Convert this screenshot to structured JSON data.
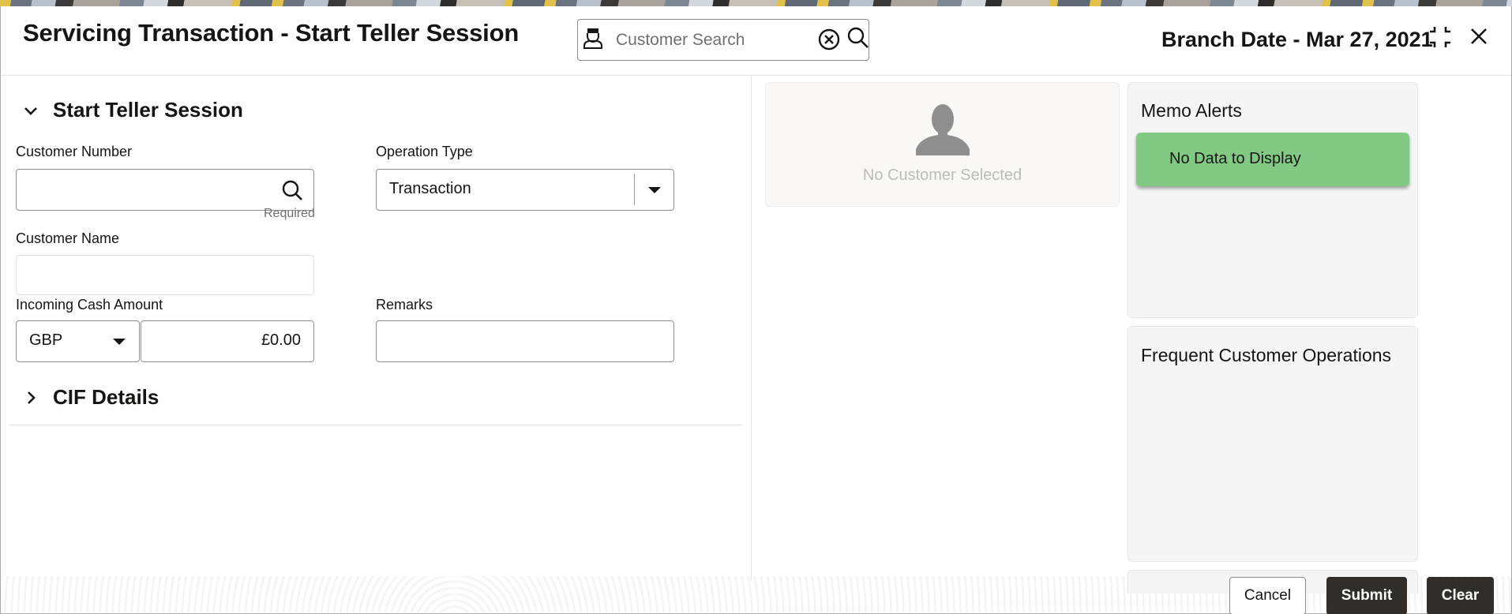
{
  "header": {
    "title": "Servicing Transaction - Start Teller Session",
    "customer_search": {
      "placeholder": "Customer Search",
      "value": ""
    },
    "branch_date": "Branch Date - Mar 27, 2021",
    "icons": {
      "person": "customer-person-icon",
      "clear": "clear-circle-x-icon",
      "search": "search-icon",
      "collapse": "collapse-icon",
      "close": "close-icon"
    }
  },
  "form": {
    "section_title": "Start Teller Session",
    "customer_number": {
      "label": "Customer Number",
      "value": "",
      "hint": "Required"
    },
    "operation_type": {
      "label": "Operation Type",
      "selected": "Transaction"
    },
    "customer_name": {
      "label": "Customer Name",
      "value": ""
    },
    "incoming_cash": {
      "label": "Incoming Cash Amount",
      "currency": "GBP",
      "amount": "£0.00"
    },
    "remarks": {
      "label": "Remarks",
      "value": ""
    },
    "cif_section_title": "CIF Details"
  },
  "customer_card": {
    "message": "No Customer Selected"
  },
  "memo_alerts": {
    "title": "Memo Alerts",
    "message": "No Data to Display",
    "color": "#82ca83"
  },
  "frequent_ops": {
    "title": "Frequent Customer Operations"
  },
  "footer": {
    "cancel": "Cancel",
    "submit": "Submit",
    "clear": "Clear"
  }
}
